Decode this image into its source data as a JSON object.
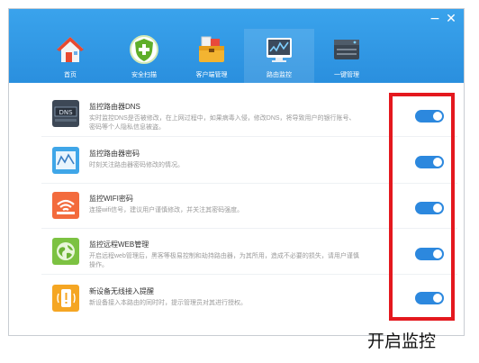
{
  "window": {
    "minimize_glyph": "−",
    "close_glyph": "✕"
  },
  "nav": {
    "items": [
      {
        "label": "首页",
        "icon": "home-icon"
      },
      {
        "label": "安全扫描",
        "icon": "shield-plus-icon"
      },
      {
        "label": "客户端管理",
        "icon": "toolbox-icon"
      },
      {
        "label": "路由监控",
        "icon": "monitor-chart-icon",
        "active": true
      },
      {
        "label": "一键管理",
        "icon": "router-device-icon"
      }
    ]
  },
  "rows": [
    {
      "title": "监控路由器DNS",
      "desc": "实时监控DNS是否被修改，在上网过程中，如果病毒入侵，修改DNS，将导致用户的银行账号、密码等个人隐私信息被盗。",
      "icon": "dns-server-icon",
      "enabled": true
    },
    {
      "title": "监控路由器密码",
      "desc": "时刻关注路由器密码修改的情况。",
      "icon": "password-chart-icon",
      "enabled": true
    },
    {
      "title": "监控WIFI密码",
      "desc": "连接wifi信号，建议用户谨慎修改，并关注其密码强度。",
      "icon": "wifi-icon",
      "enabled": true
    },
    {
      "title": "监控远程WEB管理",
      "desc": "开启远程web管理后，黑客等极易控制和劫持路由器，为其所用，造成不必要的损失，请用户谨慎操作。",
      "icon": "globe-icon",
      "enabled": true
    },
    {
      "title": "新设备无线接入提醒",
      "desc": "新设备接入本路由的同时时，提示管理员对其进行授权。",
      "icon": "phone-alert-icon",
      "enabled": true
    }
  ],
  "colors": {
    "header": "#2a8fde",
    "toggle_on": "#2c88de",
    "highlight": "#e4181e"
  },
  "caption": "开启监控"
}
